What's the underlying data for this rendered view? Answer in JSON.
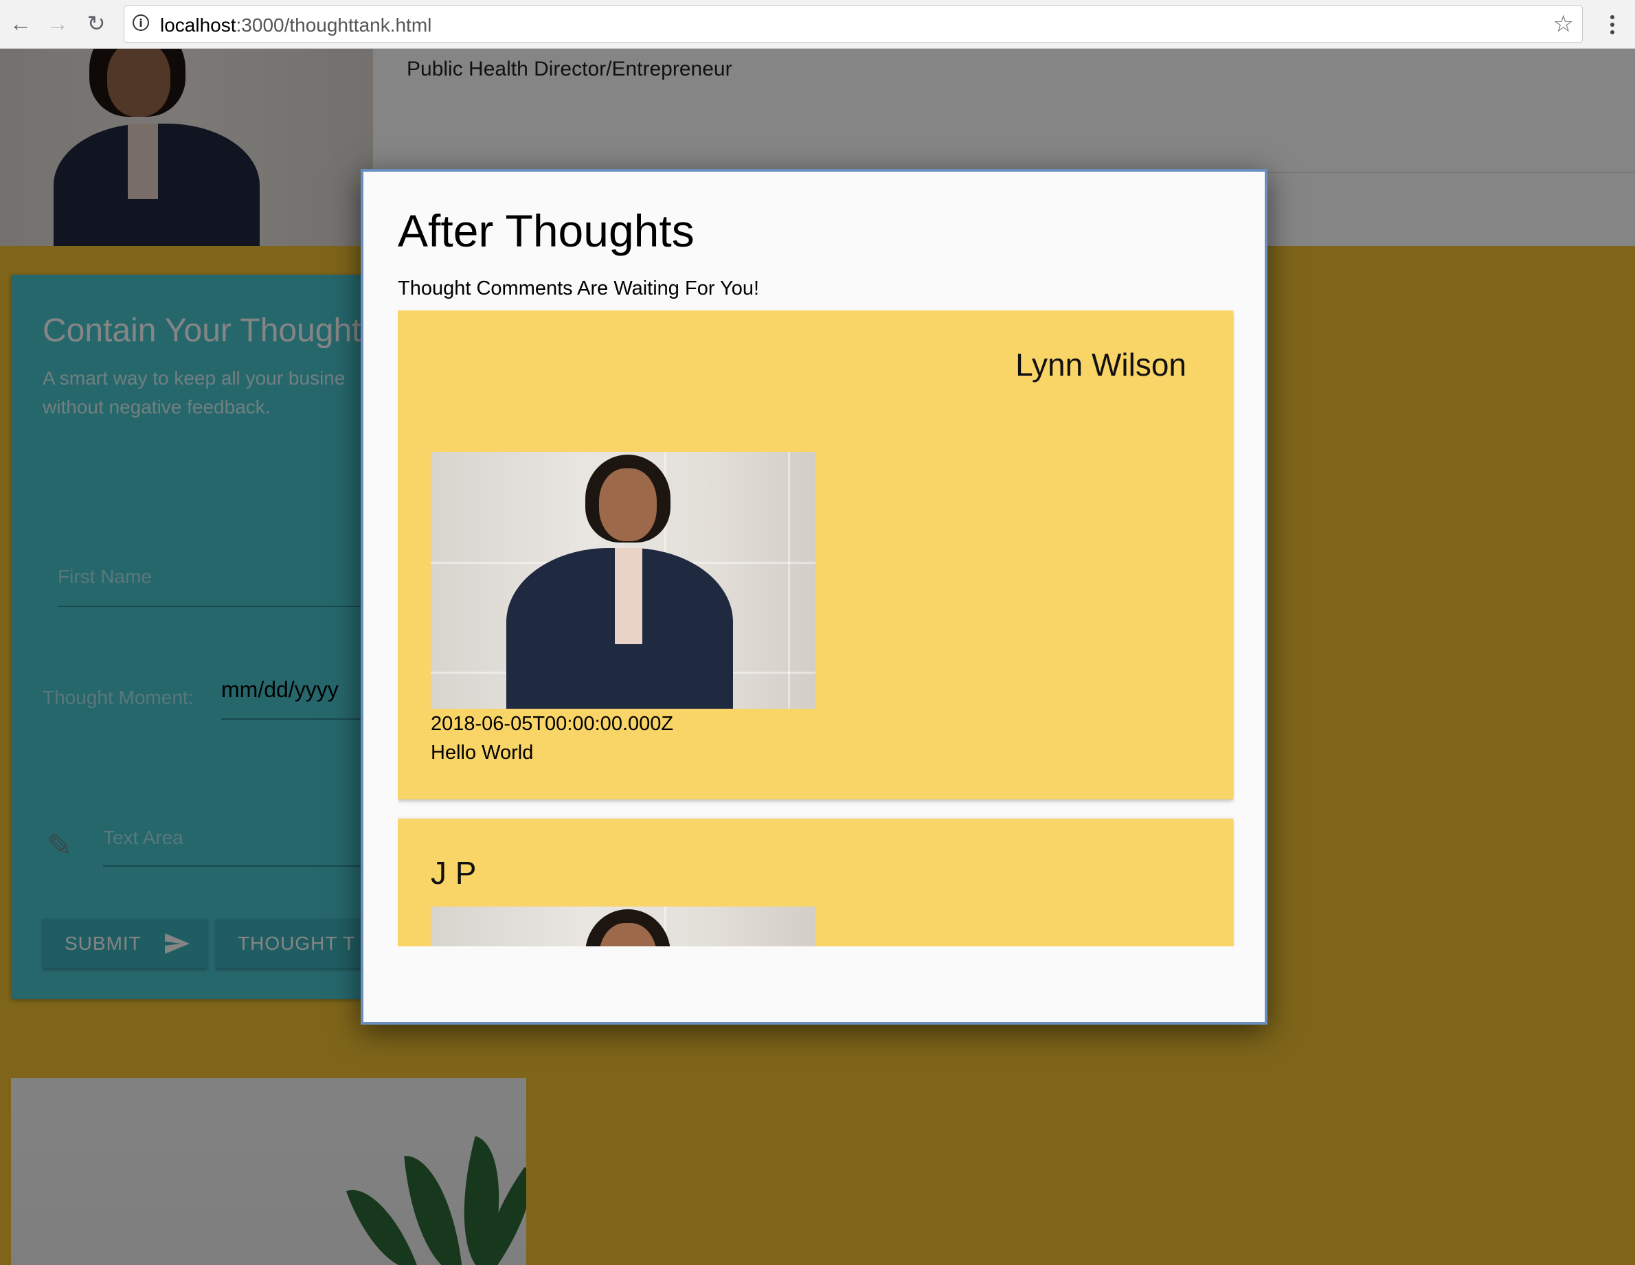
{
  "browser": {
    "url_host": "localhost",
    "url_path": ":3000/thoughttank.html",
    "back_icon": "←",
    "forward_icon": "→",
    "reload_icon": "↻",
    "star_icon": "☆"
  },
  "profile": {
    "role": "Public Health Director/Entrepreneur"
  },
  "form": {
    "title": "Contain Your Thoughts!",
    "subtitle_line1": "A smart way to keep all your busine",
    "subtitle_line2": "without negative feedback.",
    "first_name_label": "First Name",
    "thought_moment_label": "Thought Moment:",
    "date_value": "mm/dd/yyyy",
    "text_area_label": "Text Area",
    "submit_label": "SUBMIT",
    "second_button_label": "THOUGHT T"
  },
  "modal": {
    "title": "After Thoughts",
    "subtitle": "Thought Comments Are Waiting For You!",
    "comments": [
      {
        "name": "Lynn Wilson",
        "date": "2018-06-05T00:00:00.000Z",
        "text": "Hello World"
      },
      {
        "name": "J P"
      }
    ]
  },
  "colors": {
    "page_background": "#f1c232",
    "comment_card": "#f9d466",
    "form_card": "#4ac5cf",
    "modal_border": "#6a8fbf"
  }
}
